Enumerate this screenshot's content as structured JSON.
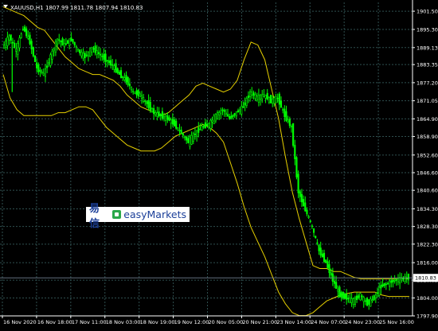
{
  "header": {
    "symbol": "XAUUSD,H1",
    "ohlc": "1807.99 1811.78 1807.94 1810.83"
  },
  "watermark": {
    "cn": "易信",
    "en": "easyMarkets"
  },
  "colors": {
    "background": "#000000",
    "candles": "#00ff00",
    "bands": "#e6d000",
    "grid": "#2f4f4f",
    "axis_text": "#ffffff",
    "price_line": "#708090"
  },
  "chart_data": {
    "type": "candlestick",
    "title": "",
    "indicator": "Bollinger Bands",
    "ylim": [
      1797.9,
      1904.5
    ],
    "y_ticks": [
      "1901.50",
      "1895.30",
      "1889.13",
      "1883.35",
      "1877.20",
      "1871.05",
      "1864.90",
      "1858.90",
      "1852.60",
      "1846.60",
      "1840.60",
      "1834.30",
      "1828.30",
      "1822.30",
      "1816.00",
      "1810.05",
      "1804.00",
      "1797.90"
    ],
    "x_ticks": [
      "16 Nov 2020",
      "16 Nov 18:00",
      "17 Nov 11:00",
      "18 Nov 03:00",
      "18 Nov 19:00",
      "19 Nov 12:00",
      "20 Nov 05:00",
      "20 Nov 21:00",
      "23 Nov 14:00",
      "24 Nov 07:00",
      "24 Nov 23:00",
      "25 Nov 16:00"
    ],
    "current_price": "1810.83",
    "price": [
      1889,
      1893,
      1888,
      1896,
      1891,
      1882,
      1880,
      1886,
      1892,
      1890,
      1892,
      1888,
      1886,
      1889,
      1887,
      1885,
      1883,
      1880,
      1878,
      1874,
      1873,
      1870,
      1867,
      1866,
      1865,
      1863,
      1860,
      1857,
      1860,
      1862,
      1863,
      1866,
      1868,
      1865,
      1867,
      1869,
      1874,
      1872,
      1873,
      1871,
      1872,
      1866,
      1862,
      1840,
      1834,
      1828,
      1820,
      1816,
      1810,
      1805,
      1804,
      1803,
      1805,
      1802,
      1804,
      1808,
      1809,
      1810,
      1810.5,
      1811
    ],
    "upper_band": [
      1903,
      1902,
      1901,
      1900,
      1898,
      1896,
      1895,
      1892,
      1889,
      1886,
      1884,
      1882,
      1881,
      1880,
      1880,
      1879,
      1878,
      1876,
      1873,
      1871,
      1869,
      1868,
      1867,
      1866,
      1867,
      1869,
      1871,
      1873,
      1876,
      1877,
      1876,
      1875,
      1874,
      1875,
      1878,
      1885,
      1891,
      1890,
      1885,
      1875,
      1865,
      1852,
      1840,
      1831,
      1823,
      1815,
      1814,
      1814,
      1813,
      1813,
      1812,
      1811,
      1810.5,
      1810.5,
      1810.5,
      1810.5,
      1810.5,
      1810.5,
      1810.5,
      1810.5
    ],
    "lower_band": [
      1880,
      1872,
      1868,
      1866,
      1866,
      1866,
      1866,
      1866,
      1867,
      1867,
      1868,
      1869,
      1869,
      1868,
      1865,
      1862,
      1860,
      1858,
      1856,
      1855,
      1854,
      1854,
      1854,
      1855,
      1857,
      1859,
      1860,
      1861,
      1862,
      1863,
      1862,
      1860,
      1857,
      1850,
      1843,
      1835,
      1828,
      1823,
      1818,
      1812,
      1806,
      1802,
      1799,
      1798,
      1798,
      1799,
      1801,
      1803,
      1804,
      1805,
      1805.5,
      1806,
      1806,
      1806,
      1806,
      1805,
      1804.5,
      1804.5,
      1804.5,
      1804.5
    ]
  }
}
